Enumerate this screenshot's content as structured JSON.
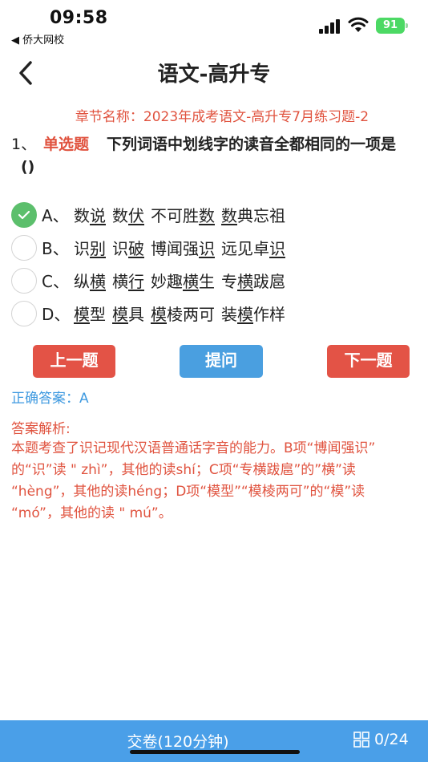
{
  "status": {
    "time": "09:58",
    "back_app": "◀ 侨大网校",
    "battery": "91"
  },
  "nav": {
    "title": "语文-高升专"
  },
  "chapter": "章节名称：2023年成考语文-高升专7月练习题-2",
  "question": {
    "number": "1、",
    "type": "单选题",
    "text": "下列词语中划线字的读音全都相同的一项是",
    "paren": "()"
  },
  "options": [
    {
      "letter": "A、",
      "words": [
        [
          "数",
          "说"
        ],
        [
          "数",
          "伏"
        ],
        [
          "不可胜",
          "数",
          ""
        ],
        [
          "",
          "数",
          "典忘祖"
        ]
      ],
      "selected": true
    },
    {
      "letter": "B、",
      "words": [
        [
          "识",
          "别"
        ],
        [
          "识",
          "破"
        ],
        [
          "博闻强",
          "识",
          ""
        ],
        [
          "远见卓",
          "识",
          ""
        ]
      ],
      "selected": false
    },
    {
      "letter": "C、",
      "words": [
        [
          "纵",
          "横",
          ""
        ],
        [
          "横",
          "行"
        ],
        [
          "妙趣",
          "横",
          "生"
        ],
        [
          "专",
          "横",
          "跋扈"
        ]
      ],
      "selected": false
    },
    {
      "letter": "D、",
      "words": [
        [
          "",
          "模",
          "型"
        ],
        [
          "",
          "模",
          "具"
        ],
        [
          "",
          "模",
          "棱两可"
        ],
        [
          "装",
          "模",
          "作样"
        ]
      ],
      "selected": false
    }
  ],
  "buttons": {
    "prev": "上一题",
    "ask": "提问",
    "next": "下一题"
  },
  "answer": "正确答案：A",
  "analysis_title": "答案解析:",
  "analysis_lines": [
    "本题考查了识记现代汉语普通话字音的能力。B项“博闻强识”",
    "的“识”读 \" zhì”，其他的读shí；C项“专横跋扈”的”横”读",
    "“hèng”，其他的读héng；D项“模型”“模棱两可”的“模”读",
    "“mó”，其他的读 \" mú”。"
  ],
  "bottom": {
    "submit": "交卷(120分钟)",
    "progress": "0/24"
  },
  "colors": {
    "accent_red": "#e0533f",
    "accent_blue": "#4a9fe8",
    "selected_green": "#5cbf6c"
  }
}
